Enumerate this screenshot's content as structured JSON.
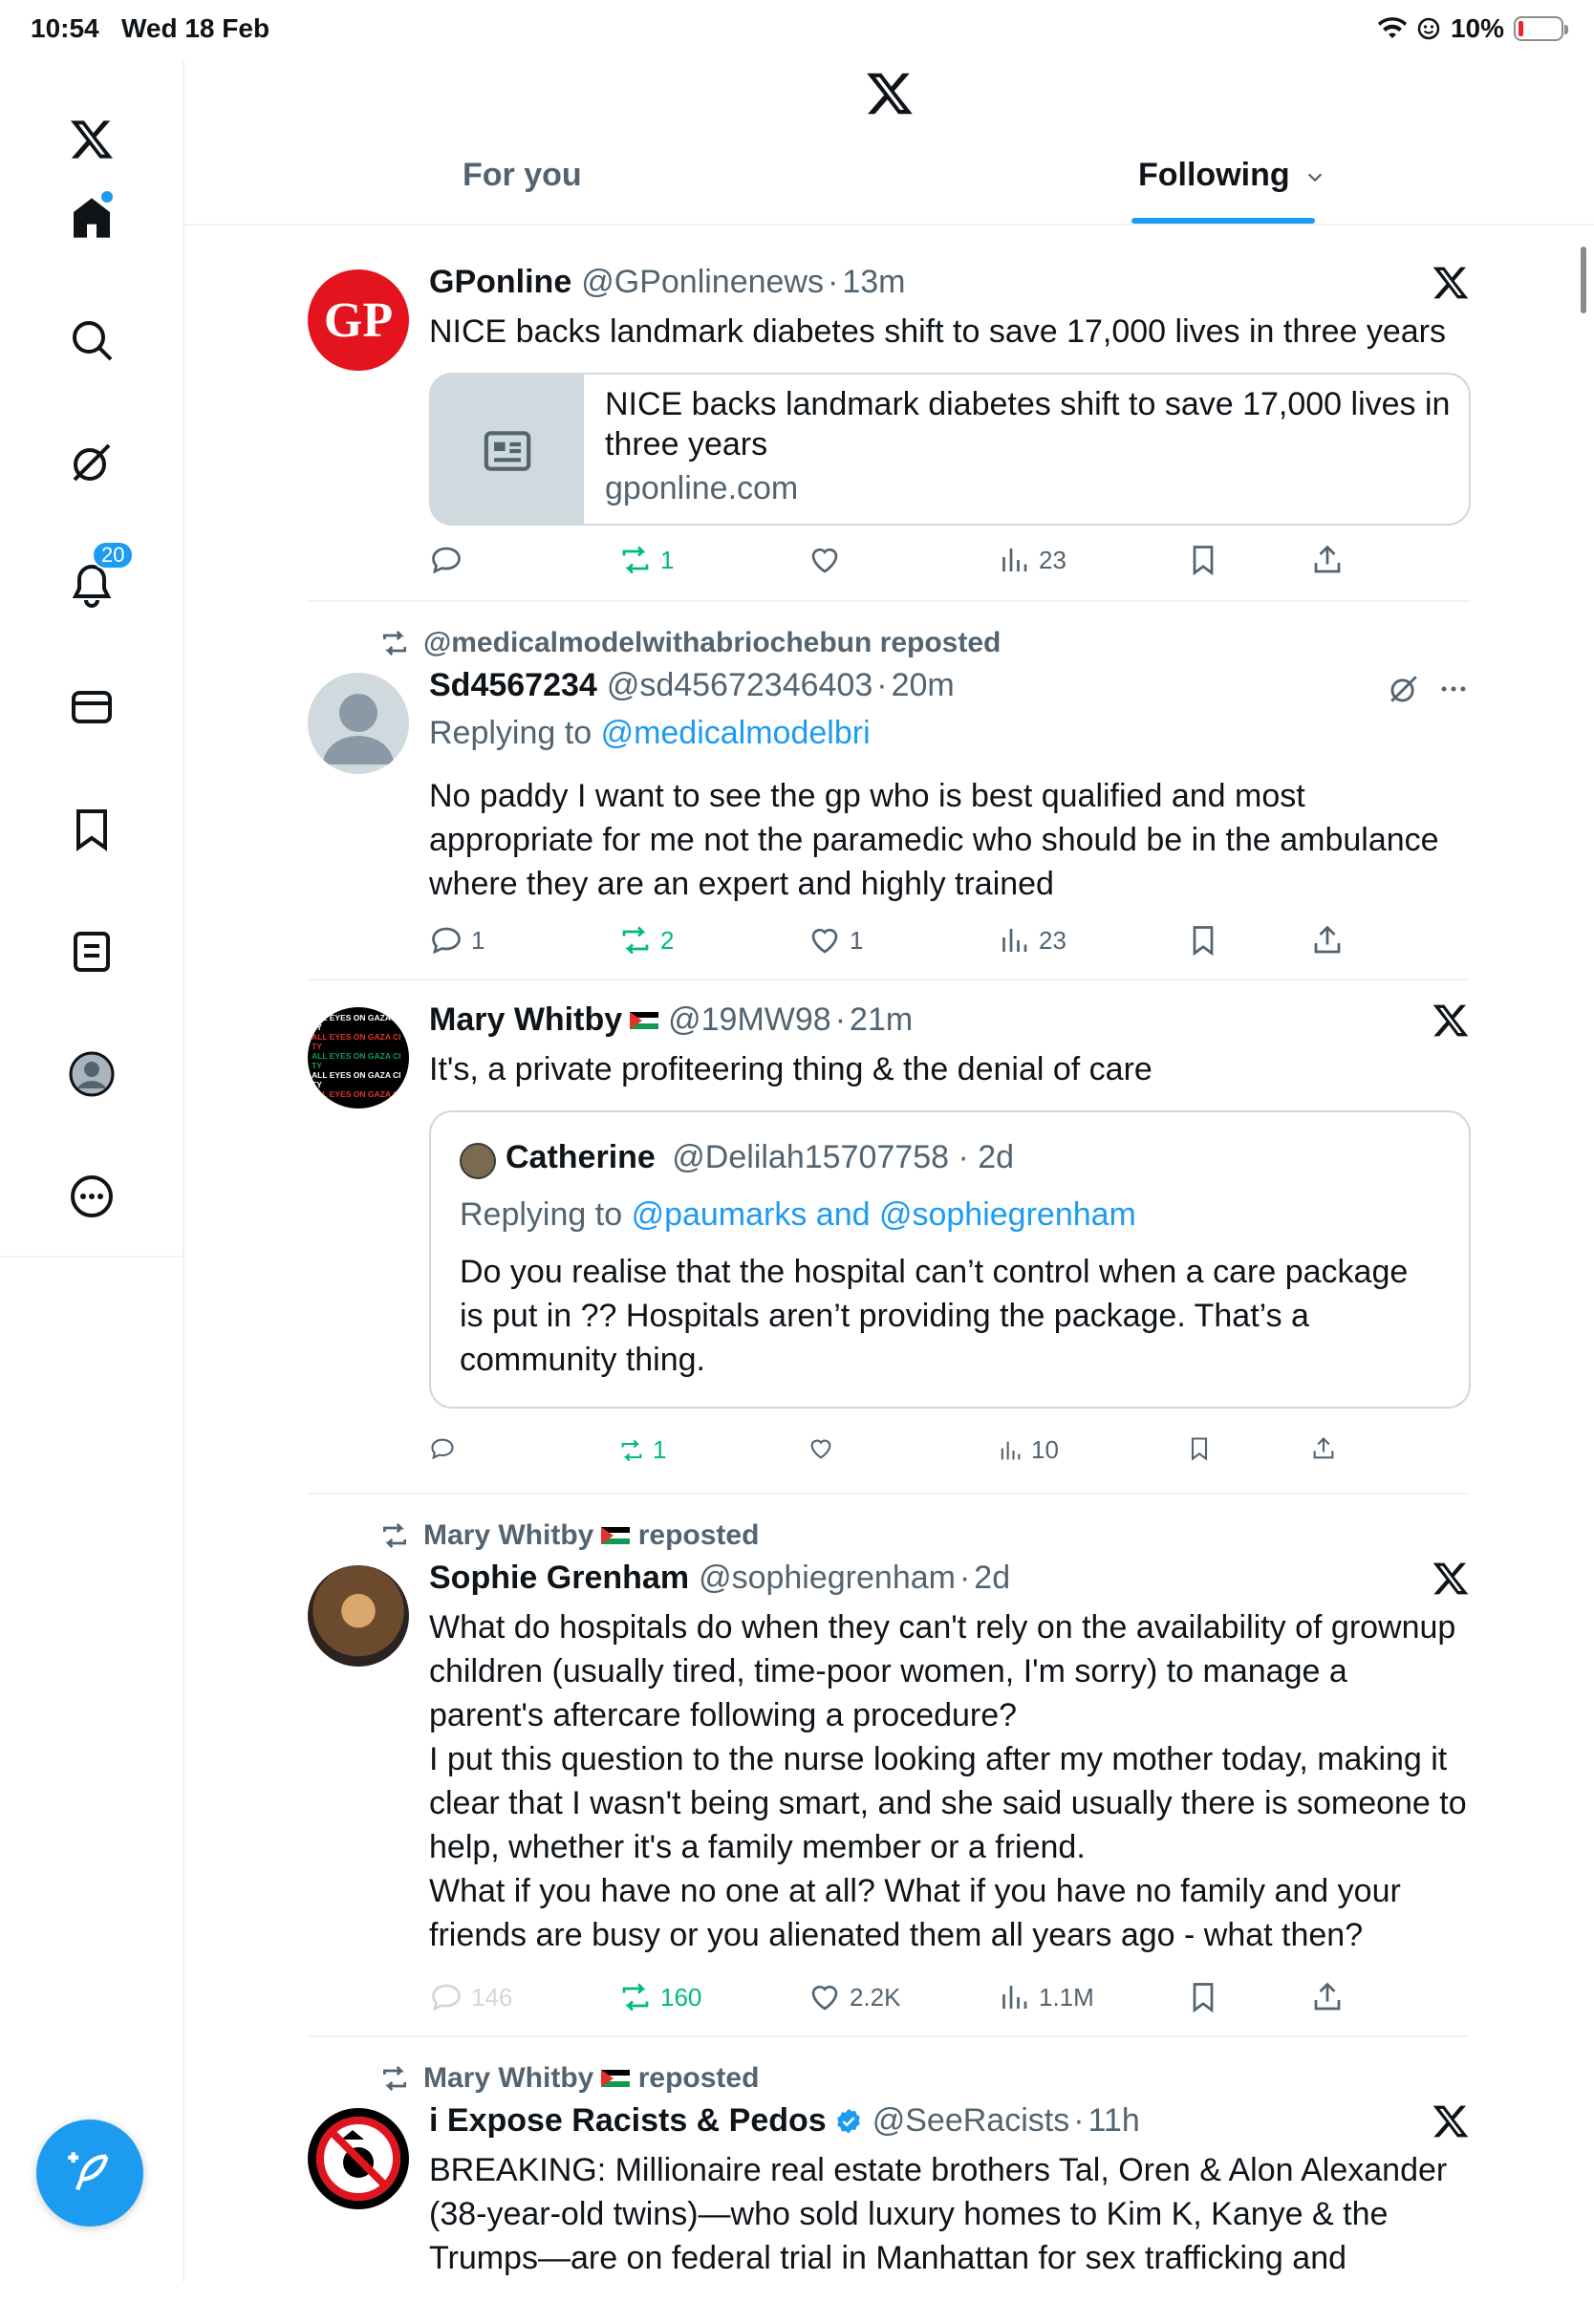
{
  "status": {
    "time": "10:54",
    "date": "Wed 18 Feb",
    "battery": "10%"
  },
  "nav": {
    "notifications_badge": "20"
  },
  "tabs": [
    {
      "label": "For you"
    },
    {
      "label": "Following"
    }
  ],
  "tweets": [
    {
      "name": "GPonline",
      "handle": "@GPonlinenews",
      "time": "13m",
      "text": "NICE backs landmark diabetes shift to save 17,000 lives in three years",
      "card": {
        "title": "NICE backs landmark diabetes shift to save 17,000 lives in three years",
        "domain": "gponline.com"
      },
      "avatar_text": "GP",
      "stats": {
        "replies": "",
        "reposts": "1",
        "likes": "",
        "views": "23"
      }
    },
    {
      "reposted_by": "@medicalmodelwithabriochebun reposted",
      "name": "Sd4567234",
      "handle": "@sd45672346403",
      "time": "20m",
      "reply_prefix": "Replying to",
      "reply_to": "@medicalmodelbri",
      "text": "No paddy I want to see the gp who is best qualified and most appropriate for me not the paramedic who should be in the ambulance where they are an expert and highly trained",
      "stats": {
        "replies": "1",
        "reposts": "2",
        "likes": "1",
        "views": "23"
      }
    },
    {
      "name": "Mary Whitby",
      "handle": "@19MW98",
      "time": "21m",
      "avatar_text": "ALL EYES ON GAZA CITY",
      "text": "It's, a private profiteering thing & the denial of care",
      "quote": {
        "name": "Catherine",
        "handle": "@Delilah15707758",
        "time": "2d",
        "reply_prefix": "Replying to",
        "reply_to": "@paumarks and @sophiegrenham",
        "text": "Do you realise that the hospital can’t control when a care package is put in ?? Hospitals aren’t providing the package. That’s a community thing."
      },
      "stats": {
        "replies": "",
        "reposts": "1",
        "likes": "",
        "views": "10"
      }
    },
    {
      "reposted_by": "Mary Whitby",
      "reposted_suffix": "reposted",
      "name": "Sophie Grenham",
      "handle": "@sophiegrenham",
      "time": "2d",
      "text": "What do hospitals do when they can't rely on the availability of grownup children (usually tired, time-poor women, I'm sorry) to manage a parent's aftercare following a procedure?\nI put this question to the nurse looking after my mother today, making it clear that I wasn't being smart, and she said usually there is someone to help, whether it's a family member or a friend.\nWhat if you have no one at all? What if you have no family and your friends are busy or you alienated them all years ago - what then?",
      "stats": {
        "replies": "146",
        "reposts": "160",
        "likes": "2.2K",
        "views": "1.1M"
      }
    },
    {
      "reposted_by": "Mary Whitby",
      "reposted_suffix": "reposted",
      "name": "i Expose Racists & Pedos",
      "handle": "@SeeRacists",
      "time": "11h",
      "text": "BREAKING: Millionaire real estate brothers Tal, Oren & Alon Alexander (38-year-old twins)—who sold luxury homes to Kim K, Kanye & the Trumps—are on federal trial in Manhattan for sex trafficking and"
    }
  ],
  "colors": {
    "accent": "#1d9bf0",
    "repost_green": "#00ba7c",
    "gp_red": "#e3141e",
    "text": "#0f1419",
    "muted": "#536471"
  }
}
